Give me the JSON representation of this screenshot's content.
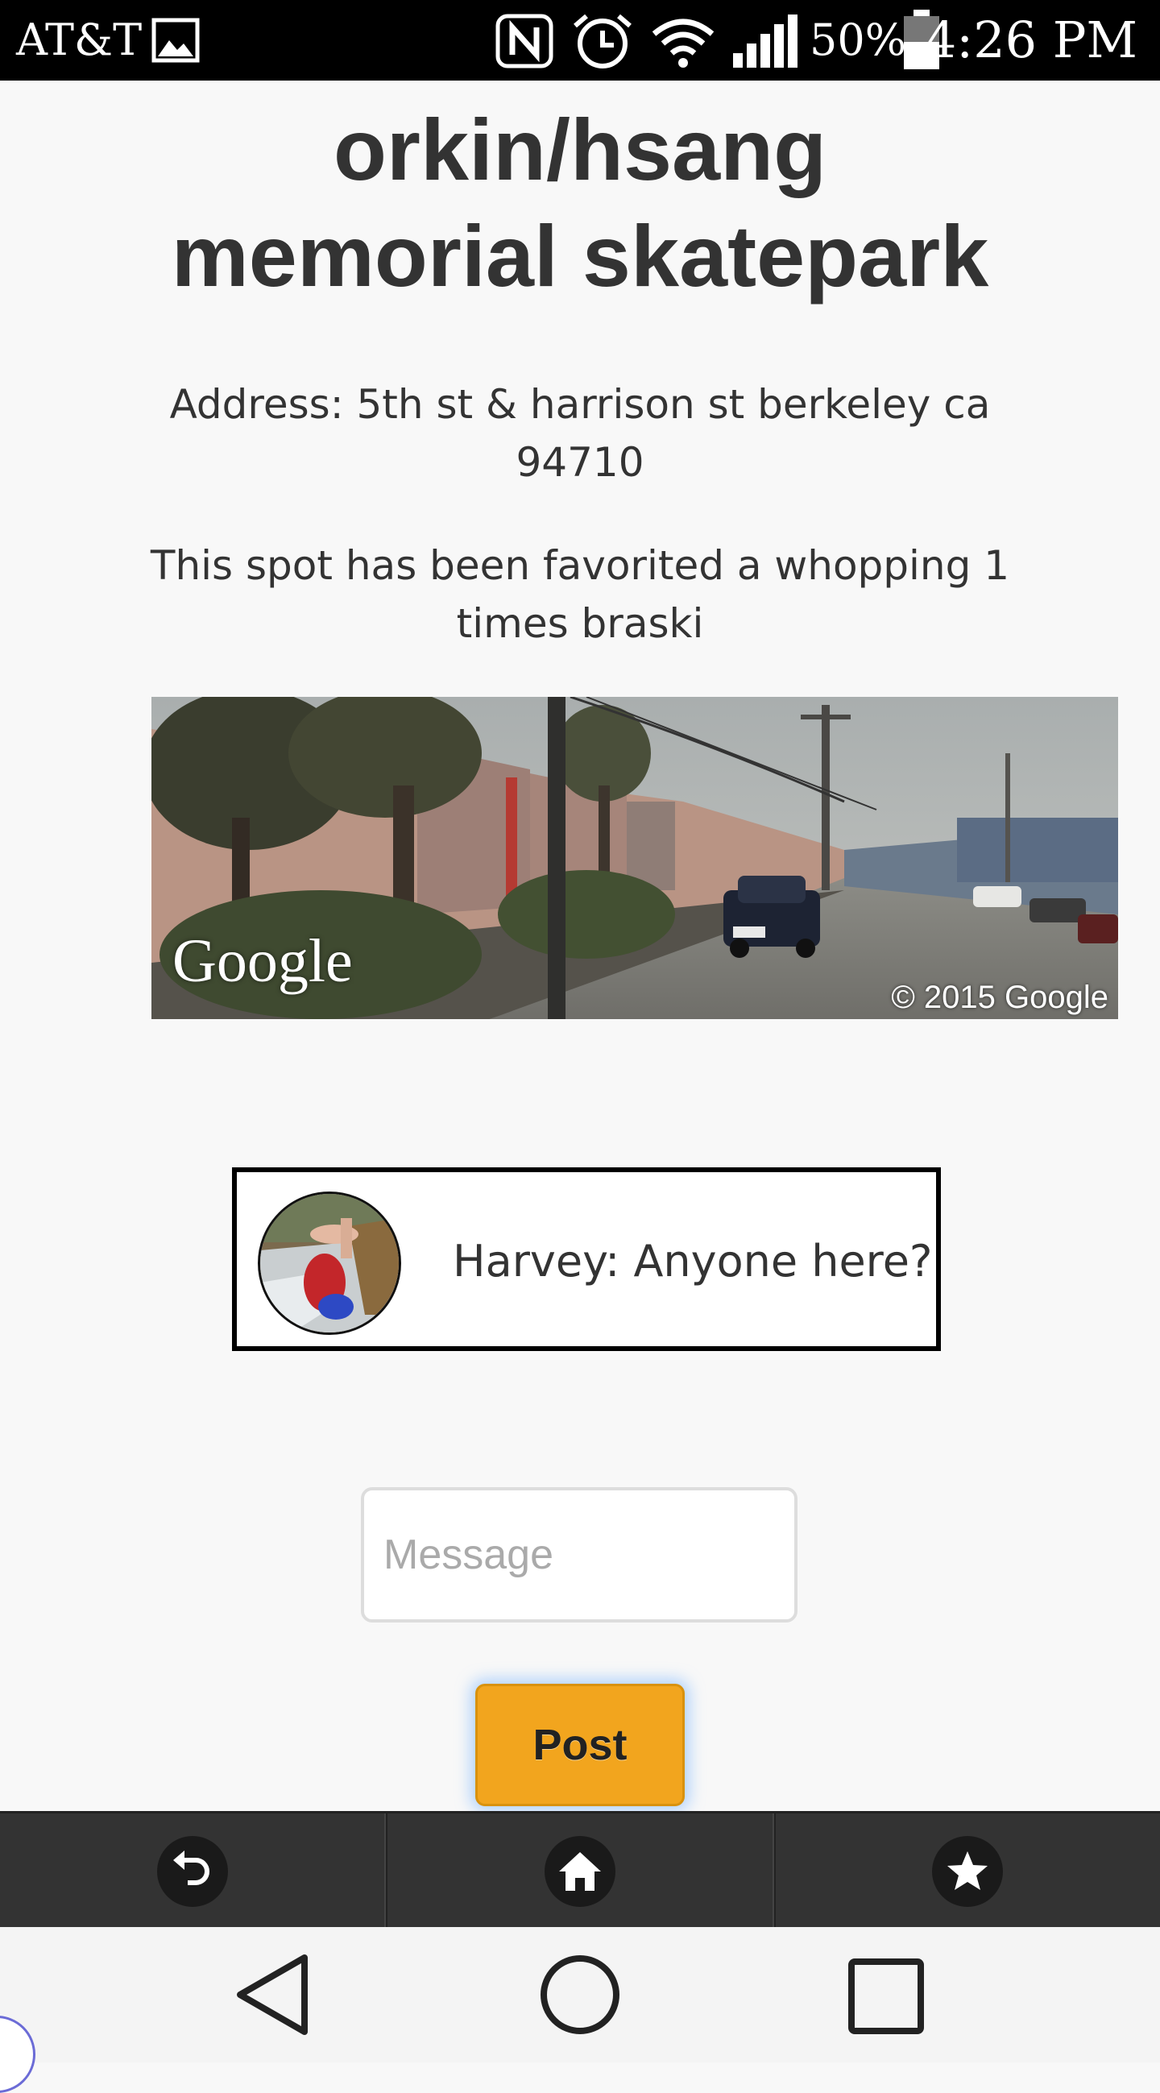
{
  "status_bar": {
    "carrier": "AT&T",
    "battery_percent": "50%",
    "time": "4:26 PM",
    "icons": [
      "gallery-icon",
      "nfc-icon",
      "alarm-icon",
      "wifi-icon",
      "signal-icon",
      "battery-icon"
    ]
  },
  "spot": {
    "title_line1": "orkin/hsang",
    "title_line2": "memorial skatepark",
    "address": "Address: 5th st & harrison st berkeley ca 94710",
    "favorites": "This spot has been favorited a whopping 1 times braski"
  },
  "street_view": {
    "logo": "Google",
    "copyright": "© 2015 Google"
  },
  "chat": {
    "messages": [
      {
        "text": "Harvey: Anyone here?"
      }
    ]
  },
  "composer": {
    "placeholder": "Message",
    "value": "",
    "post_label": "Post",
    "post_color": "#f2a51e"
  },
  "app_nav": {
    "items": [
      {
        "icon": "undo-icon"
      },
      {
        "icon": "home-icon"
      },
      {
        "icon": "star-icon"
      }
    ]
  },
  "system_nav": {
    "icons": [
      "back-icon",
      "home-circle-icon",
      "recent-apps-icon"
    ]
  }
}
